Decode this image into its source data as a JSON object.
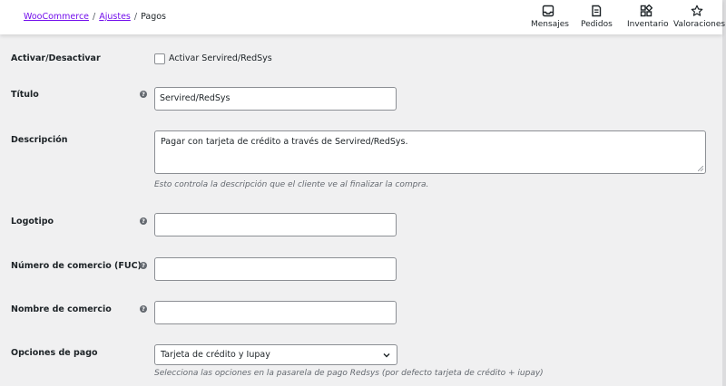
{
  "breadcrumb": {
    "root": "WooCommerce",
    "settings": "Ajustes",
    "current": "Pagos",
    "separator": "/"
  },
  "actions": [
    {
      "label": "Mensajes",
      "icon": "inbox-icon"
    },
    {
      "label": "Pedidos",
      "icon": "orders-icon"
    },
    {
      "label": "Inventario",
      "icon": "inventory-icon"
    },
    {
      "label": "Valoraciones",
      "icon": "star-icon"
    }
  ],
  "form": {
    "enable": {
      "label": "Activar/Desactivar",
      "checkbox_label": "Activar Servired/RedSys",
      "checked": false
    },
    "title": {
      "label": "Título",
      "value": "Servired/RedSys"
    },
    "description": {
      "label": "Descripción",
      "value": "Pagar con tarjeta de crédito a través de Servired/RedSys.",
      "help_text": "Esto controla la descripción que el cliente ve al finalizar la compra."
    },
    "logo": {
      "label": "Logotipo",
      "value": ""
    },
    "merchant_code": {
      "label": "Número de comercio (FUC)",
      "value": ""
    },
    "merchant_name": {
      "label": "Nombre de comercio",
      "value": ""
    },
    "payment_options": {
      "label": "Opciones de pago",
      "selected": "Tarjeta de crédito y Iupay",
      "help_text": "Selecciona las opciones en la pasarela de pago Redsys (por defecto tarjeta de crédito + iupay)"
    }
  },
  "colors": {
    "link": "#720eec",
    "background": "#f0f0f1",
    "header": "#ffffff",
    "border": "#8c8f94",
    "help_icon": "#646970"
  }
}
